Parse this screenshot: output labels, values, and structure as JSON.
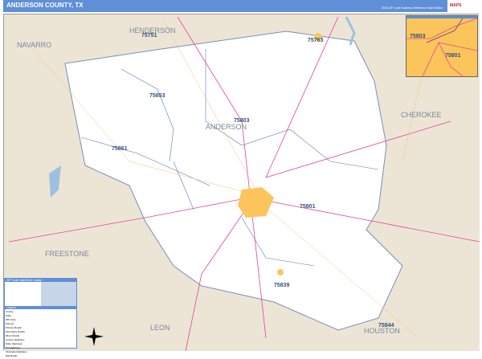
{
  "header": {
    "title": "ANDERSON COUNTY, TX",
    "subtitle": "2020 ZIP Code Business Reference Inset Edition",
    "logo": "MAPS"
  },
  "counties": [
    "NAVARRO",
    "HENDERSON",
    "CHEROKEE",
    "FREESTONE",
    "LEON",
    "HOUSTON",
    "ANDERSON"
  ],
  "zips": [
    "75751",
    "75763",
    "75853",
    "75803",
    "75861",
    "75801",
    "75839",
    "75844"
  ],
  "inset": {
    "zips": [
      "75803",
      "75801"
    ]
  },
  "legend": {
    "title": "ZIP Code Index/Grid Locator",
    "section": "Legend",
    "rows": [
      "County",
      "State",
      "ZIP Code",
      "Parcels",
      "Primary Roads",
      "Secondary Roads",
      "Minor Roads",
      "County Highways",
      "State Highways",
      "US Highways",
      "Interstate Highways",
      "Rail Roads"
    ]
  },
  "colors": {
    "header": "#5f8fd6",
    "county": "#ffffff",
    "surround": "#ece5d6",
    "city": "#fcc55b",
    "zipline": "#5a7bb5",
    "highway": "#e0449a"
  }
}
